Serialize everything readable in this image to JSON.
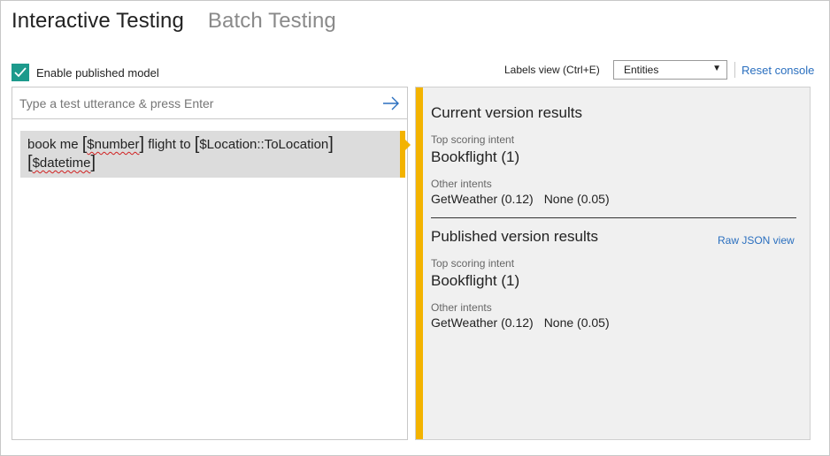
{
  "tabs": [
    {
      "label": "Interactive Testing",
      "active": true
    },
    {
      "label": "Batch Testing",
      "active": false
    }
  ],
  "enable_published": {
    "label": "Enable published model",
    "checked": true
  },
  "labels_view": {
    "label": "Labels view (Ctrl+E)",
    "selected": "Entities"
  },
  "reset_console": "Reset console",
  "input": {
    "placeholder": "Type a test utterance & press Enter",
    "value": ""
  },
  "utterance": {
    "tokens": [
      {
        "text": "book me",
        "entity": false
      },
      {
        "text": "$number",
        "entity": true
      },
      {
        "text": "flight to",
        "entity": false
      },
      {
        "text": "$Location::ToLocation",
        "entity": true
      },
      {
        "text": "$datetime",
        "entity": true
      }
    ]
  },
  "current": {
    "title": "Current version results",
    "top_label": "Top scoring intent",
    "top_intent": "Bookflight (1)",
    "other_label": "Other intents",
    "other_intents": [
      "GetWeather (0.12)",
      "None (0.05)"
    ]
  },
  "published": {
    "title": "Published version results",
    "raw_json": "Raw JSON view",
    "top_label": "Top scoring intent",
    "top_intent": "Bookflight (1)",
    "other_label": "Other intents",
    "other_intents": [
      "GetWeather (0.12)",
      "None (0.05)"
    ]
  },
  "colors": {
    "accent_yellow": "#f3b300",
    "checkbox_teal": "#1d9a8c",
    "link_blue": "#2a6fbf"
  },
  "icons": {
    "check": "checkmark-icon",
    "submit": "arrow-right-icon",
    "dropdown": "caret-down-icon"
  }
}
